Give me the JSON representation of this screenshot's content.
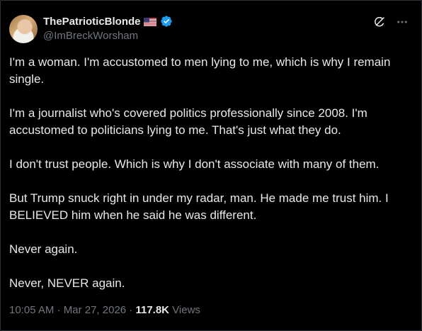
{
  "author": {
    "display_name": "ThePatrioticBlonde",
    "flag_icon": "us-flag-icon",
    "verified_icon": "verified-badge-icon",
    "verified_color": "#1d9bf0",
    "handle": "@ImBreckWorsham"
  },
  "header_actions": {
    "grok_icon": "grok-icon",
    "more_icon": "more-icon"
  },
  "tweet": {
    "paragraphs": [
      "I'm a woman. I'm accustomed to men lying to me, which is why I remain single.",
      "I'm a journalist who's covered politics professionally since 2008. I'm accustomed to politicians lying to me. That's just what they do.",
      "I don't trust people. Which is why I don't associate with many of them.",
      "But Trump snuck right in under my radar, man. He made me trust him. I BELIEVED him when he said he was different.",
      "Never again.",
      "Never, NEVER again."
    ]
  },
  "meta": {
    "time": "10:05 AM",
    "separator": "·",
    "date": "Mar 27, 2026",
    "views_count": "117.8K",
    "views_label": "Views"
  },
  "colors": {
    "background": "#000000",
    "text_primary": "#e7e9ea",
    "text_secondary": "#71767b",
    "border": "#2f3336"
  }
}
